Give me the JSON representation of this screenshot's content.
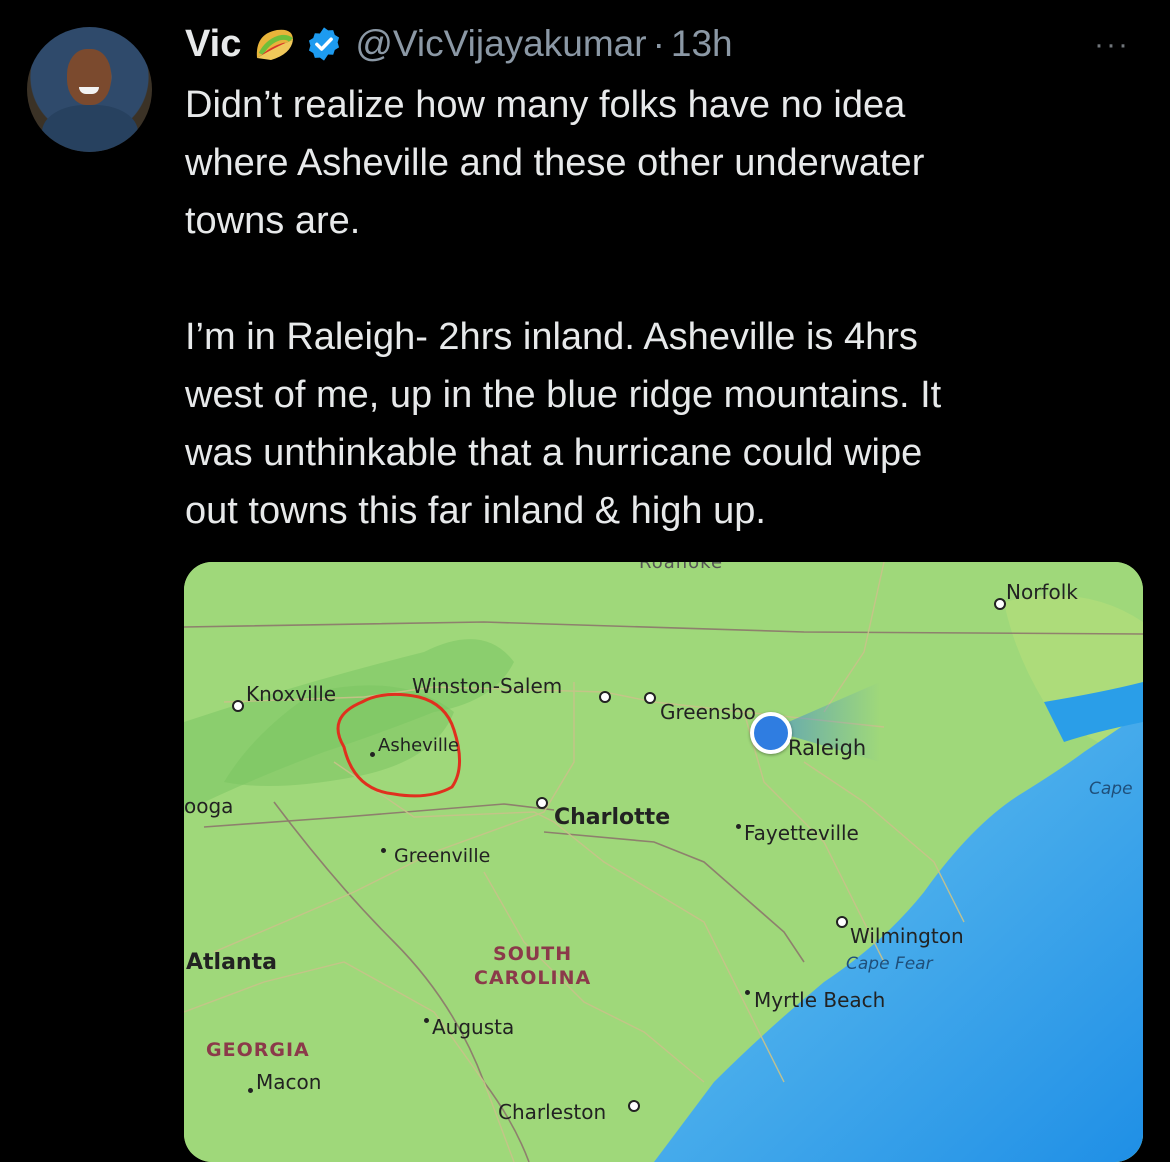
{
  "tweet": {
    "author_name": "Vic",
    "handle": "@VicVijayakumar",
    "separator": "·",
    "time": "13h",
    "more_label": "···",
    "text": "Didn’t realize how many folks have no idea\nwhere Asheville and these other underwater\ntowns are.\n\nI’m in Raleigh- 2hrs inland. Asheville is 4hrs\nwest of me, up in the blue ridge mountains. It\nwas unthinkable that a hurricane could wipe\nout towns this far inland & high up."
  },
  "map": {
    "places": {
      "roanoke": "Roanoke",
      "norfolk": "Norfolk",
      "knoxville": "Knoxville",
      "winston_salem": "Winston-Salem",
      "greensboro": "Greensbo",
      "asheville": "Asheville",
      "raleigh": "Raleigh",
      "chattanooga": "ooga",
      "charlotte": "Charlotte",
      "fayetteville": "Fayetteville",
      "cape": "Cape",
      "greenville": "Greenville",
      "wilmington": "Wilmington",
      "cape_fear": "Cape Fear",
      "atlanta": "Atlanta",
      "south_carolina": "SOUTH\nCAROLINA",
      "myrtle_beach": "Myrtle Beach",
      "augusta": "Augusta",
      "georgia": "GEORGIA",
      "macon": "Macon",
      "charleston": "Charleston"
    },
    "colors": {
      "land": "#9fd87a",
      "ocean": "#2a9ee8",
      "annotation_circle": "#e0301e",
      "location_dot": "#2f7de1"
    }
  }
}
